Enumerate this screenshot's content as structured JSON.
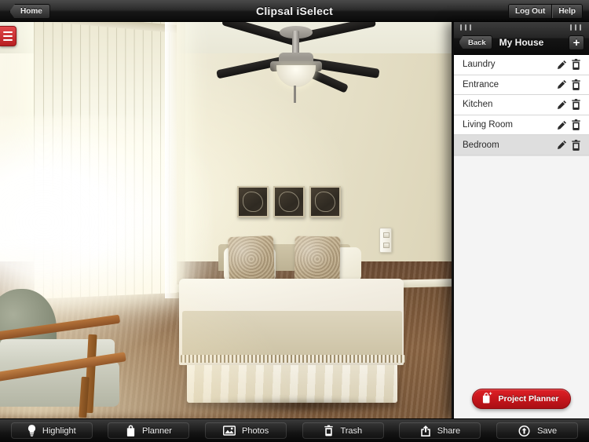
{
  "topbar": {
    "home_label": "Home",
    "title": "Clipsal iSelect",
    "logout_label": "Log Out",
    "help_label": "Help"
  },
  "stage": {
    "menu_button_name": "hamburger-menu-icon",
    "scene_description": "Bedroom photo with ceiling fan, vertical blinds, bed, triptych wall art, light switch and power outlet"
  },
  "panel": {
    "back_label": "Back",
    "title": "My House",
    "add_label": "+",
    "rooms": [
      {
        "label": "Laundry",
        "selected": false
      },
      {
        "label": "Entrance",
        "selected": false
      },
      {
        "label": "Kitchen",
        "selected": false
      },
      {
        "label": "Living Room",
        "selected": false
      },
      {
        "label": "Bedroom",
        "selected": true
      }
    ],
    "edit_icon": "pencil-icon",
    "delete_icon": "trash-icon",
    "planner_label": "Project Planner",
    "planner_icon": "shopping-bag-plus-icon",
    "planner_color": "#c3151b"
  },
  "toolbar": {
    "items": [
      {
        "label": "Highlight",
        "icon": "lightbulb-icon"
      },
      {
        "label": "Planner",
        "icon": "shopping-bag-icon"
      },
      {
        "label": "Photos",
        "icon": "photo-icon"
      },
      {
        "label": "Trash",
        "icon": "trash-icon"
      },
      {
        "label": "Share",
        "icon": "share-icon"
      },
      {
        "label": "Save",
        "icon": "cloud-upload-icon"
      }
    ]
  }
}
